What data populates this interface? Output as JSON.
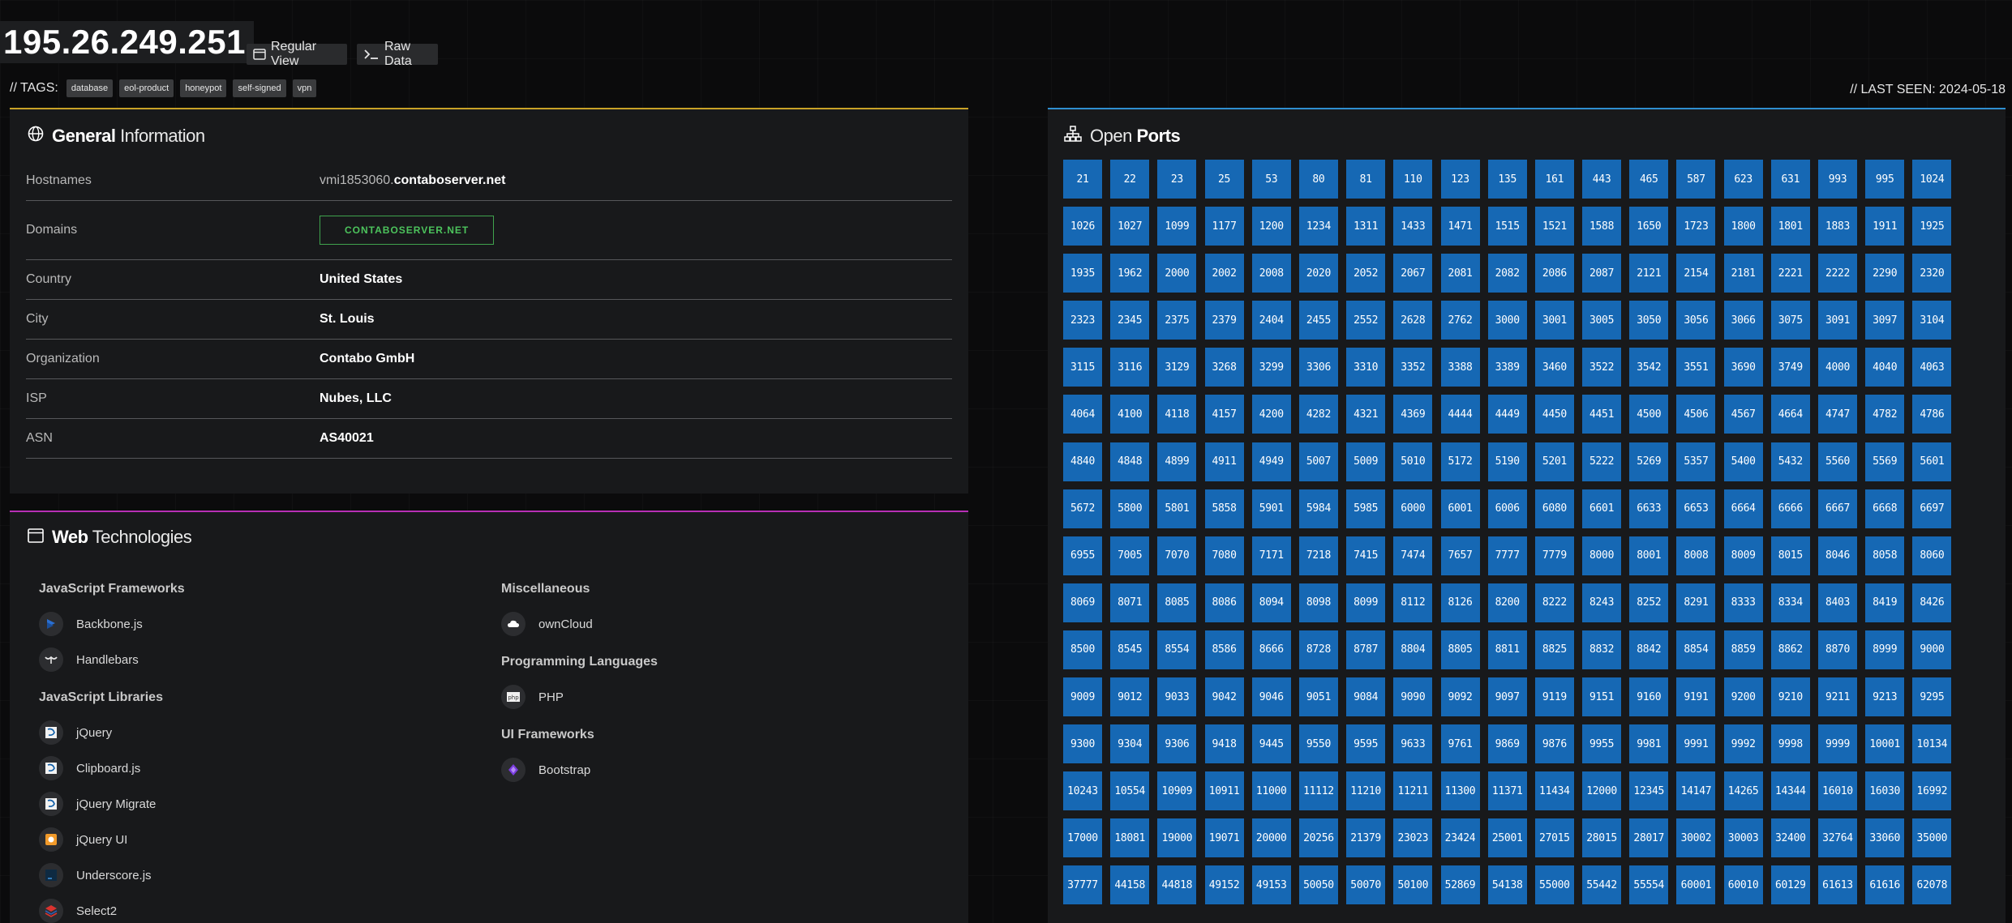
{
  "header": {
    "ip": "195.26.249.251",
    "regular_view_label": "Regular View",
    "raw_data_label": "Raw Data",
    "tags_label": "// TAGS:",
    "tags": [
      "database",
      "eol-product",
      "honeypot",
      "self-signed",
      "vpn"
    ],
    "last_seen": "// LAST SEEN: 2024-05-18"
  },
  "general": {
    "title_bold": "General",
    "title_rest": "Information",
    "icon": "globe-icon",
    "rows": [
      {
        "key": "Hostnames",
        "host_prefix": "vmi1853060.",
        "value": "contaboserver.net"
      },
      {
        "key": "Domains",
        "value": "CONTABOSERVER.NET"
      },
      {
        "key": "Country",
        "value": "United States"
      },
      {
        "key": "City",
        "value": "St. Louis"
      },
      {
        "key": "Organization",
        "value": "Contabo GmbH"
      },
      {
        "key": "ISP",
        "value": "Nubes, LLC"
      },
      {
        "key": "ASN",
        "value": "AS40021"
      }
    ],
    "accent_color": "#c9a227"
  },
  "web": {
    "title_bold": "Web",
    "title_rest": "Technologies",
    "icon": "browser-window-icon",
    "accent_color": "#b72fb5",
    "left": [
      {
        "category": "JavaScript Frameworks",
        "items": [
          "Backbone.js",
          "Handlebars"
        ]
      },
      {
        "category": "JavaScript Libraries",
        "items": [
          "jQuery",
          "Clipboard.js",
          "jQuery Migrate",
          "jQuery UI",
          "Underscore.js",
          "Select2"
        ]
      }
    ],
    "right": [
      {
        "category": "Miscellaneous",
        "items": [
          "ownCloud"
        ]
      },
      {
        "category": "Programming Languages",
        "items": [
          "PHP"
        ]
      },
      {
        "category": "UI Frameworks",
        "items": [
          "Bootstrap"
        ]
      }
    ]
  },
  "ports": {
    "title_bold": "Ports",
    "title_rest": "Open",
    "icon": "network-sitemap-icon",
    "accent_color": "#2f8fd0",
    "port_color": "#1668b4",
    "list": [
      "21",
      "22",
      "23",
      "25",
      "53",
      "80",
      "81",
      "110",
      "123",
      "135",
      "161",
      "443",
      "465",
      "587",
      "623",
      "631",
      "993",
      "995",
      "1024",
      "1026",
      "1027",
      "1099",
      "1177",
      "1200",
      "1234",
      "1311",
      "1433",
      "1471",
      "1515",
      "1521",
      "1588",
      "1650",
      "1723",
      "1800",
      "1801",
      "1883",
      "1911",
      "1925",
      "1935",
      "1962",
      "2000",
      "2002",
      "2008",
      "2020",
      "2052",
      "2067",
      "2081",
      "2082",
      "2086",
      "2087",
      "2121",
      "2154",
      "2181",
      "2221",
      "2222",
      "2290",
      "2320",
      "2323",
      "2345",
      "2375",
      "2379",
      "2404",
      "2455",
      "2552",
      "2628",
      "2762",
      "3000",
      "3001",
      "3005",
      "3050",
      "3056",
      "3066",
      "3075",
      "3091",
      "3097",
      "3104",
      "3115",
      "3116",
      "3129",
      "3268",
      "3299",
      "3306",
      "3310",
      "3352",
      "3388",
      "3389",
      "3460",
      "3522",
      "3542",
      "3551",
      "3690",
      "3749",
      "4000",
      "4040",
      "4063",
      "4064",
      "4100",
      "4118",
      "4157",
      "4200",
      "4282",
      "4321",
      "4369",
      "4444",
      "4449",
      "4450",
      "4451",
      "4500",
      "4506",
      "4567",
      "4664",
      "4747",
      "4782",
      "4786",
      "4840",
      "4848",
      "4899",
      "4911",
      "4949",
      "5007",
      "5009",
      "5010",
      "5172",
      "5190",
      "5201",
      "5222",
      "5269",
      "5357",
      "5400",
      "5432",
      "5560",
      "5569",
      "5601",
      "5672",
      "5800",
      "5801",
      "5858",
      "5901",
      "5984",
      "5985",
      "6000",
      "6001",
      "6006",
      "6080",
      "6601",
      "6633",
      "6653",
      "6664",
      "6666",
      "6667",
      "6668",
      "6697",
      "6955",
      "7005",
      "7070",
      "7080",
      "7171",
      "7218",
      "7415",
      "7474",
      "7657",
      "7777",
      "7779",
      "8000",
      "8001",
      "8008",
      "8009",
      "8015",
      "8046",
      "8058",
      "8060",
      "8069",
      "8071",
      "8085",
      "8086",
      "8094",
      "8098",
      "8099",
      "8112",
      "8126",
      "8200",
      "8222",
      "8243",
      "8252",
      "8291",
      "8333",
      "8334",
      "8403",
      "8419",
      "8426",
      "8500",
      "8545",
      "8554",
      "8586",
      "8666",
      "8728",
      "8787",
      "8804",
      "8805",
      "8811",
      "8825",
      "8832",
      "8842",
      "8854",
      "8859",
      "8862",
      "8870",
      "8999",
      "9000",
      "9009",
      "9012",
      "9033",
      "9042",
      "9046",
      "9051",
      "9084",
      "9090",
      "9092",
      "9097",
      "9119",
      "9151",
      "9160",
      "9191",
      "9200",
      "9210",
      "9211",
      "9213",
      "9295",
      "9300",
      "9304",
      "9306",
      "9418",
      "9445",
      "9550",
      "9595",
      "9633",
      "9761",
      "9869",
      "9876",
      "9955",
      "9981",
      "9991",
      "9992",
      "9998",
      "9999",
      "10001",
      "10134",
      "10243",
      "10554",
      "10909",
      "10911",
      "11000",
      "11112",
      "11210",
      "11211",
      "11300",
      "11371",
      "11434",
      "12000",
      "12345",
      "14147",
      "14265",
      "14344",
      "16010",
      "16030",
      "16992",
      "17000",
      "18081",
      "19000",
      "19071",
      "20000",
      "20256",
      "21379",
      "23023",
      "23424",
      "25001",
      "27015",
      "28015",
      "28017",
      "30002",
      "30003",
      "32400",
      "32764",
      "33060",
      "35000",
      "37777",
      "44158",
      "44818",
      "49152",
      "49153",
      "50050",
      "50070",
      "50100",
      "52869",
      "54138",
      "55000",
      "55442",
      "55554",
      "60001",
      "60010",
      "60129",
      "61613",
      "61616",
      "62078"
    ]
  }
}
